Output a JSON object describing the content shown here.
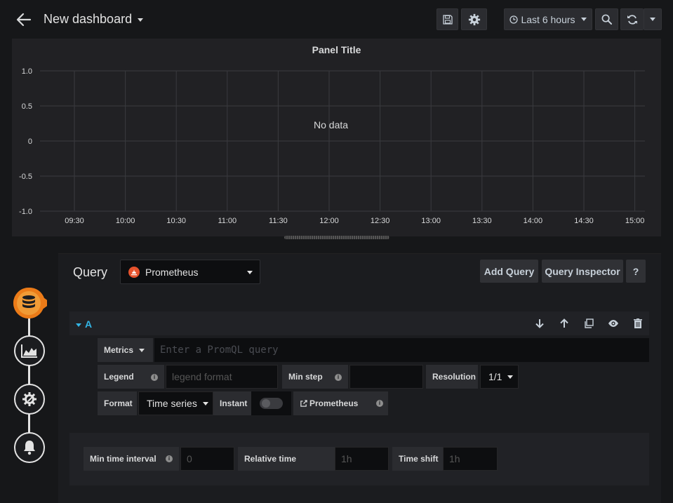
{
  "header": {
    "title": "New dashboard",
    "time_range": "Last 6 hours"
  },
  "panel": {
    "title": "Panel Title",
    "no_data": "No data"
  },
  "chart_data": {
    "type": "line",
    "title": "Panel Title",
    "xlabel": "",
    "ylabel": "",
    "x_ticks": [
      "09:30",
      "10:00",
      "10:30",
      "11:00",
      "11:30",
      "12:00",
      "12:30",
      "13:00",
      "13:30",
      "14:00",
      "14:30",
      "15:00"
    ],
    "y_ticks": [
      "1.0",
      "0.5",
      "0",
      "-0.5",
      "-1.0"
    ],
    "ylim": [
      -1.0,
      1.0
    ],
    "grid": true,
    "series": []
  },
  "editor": {
    "heading": "Query",
    "datasource": "Prometheus",
    "add_query": "Add Query",
    "query_inspector": "Query Inspector",
    "help": "?"
  },
  "query": {
    "ref_id": "A",
    "metrics_label": "Metrics",
    "promql_placeholder": "Enter a PromQL query",
    "legend_label": "Legend",
    "legend_placeholder": "legend format",
    "min_step_label": "Min step",
    "resolution_label": "Resolution",
    "resolution_value": "1/1",
    "format_label": "Format",
    "format_value": "Time series",
    "instant_label": "Instant",
    "prometheus_link": "Prometheus"
  },
  "options": {
    "min_time_interval_label": "Min time interval",
    "min_time_interval_placeholder": "0",
    "relative_time_label": "Relative time",
    "relative_time_placeholder": "1h",
    "time_shift_label": "Time shift",
    "time_shift_placeholder": "1h"
  },
  "colors": {
    "accent_orange": "#eb7b18",
    "accent_blue": "#33b5e5",
    "background": "#161719"
  }
}
